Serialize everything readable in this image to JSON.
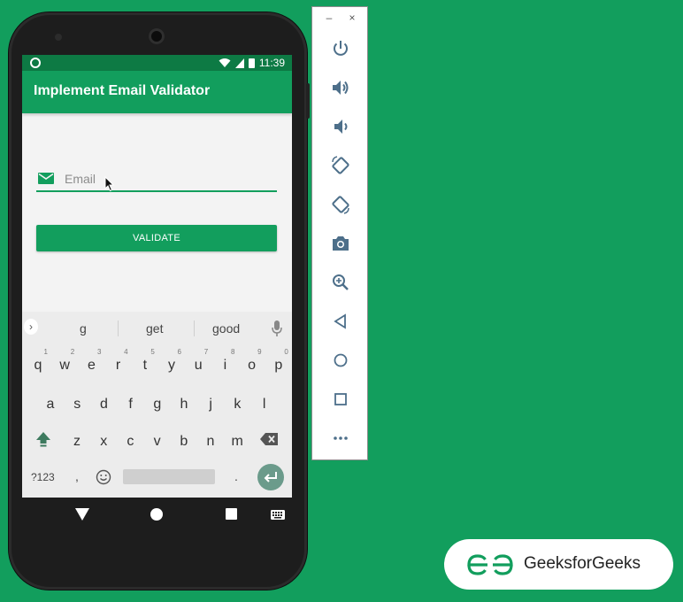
{
  "status_bar": {
    "time": "11:39"
  },
  "app": {
    "title": "Implement Email Validator",
    "email_placeholder": "Email",
    "validate_label": "VALIDATE"
  },
  "keyboard": {
    "suggestions": [
      "g",
      "get",
      "good"
    ],
    "row1": [
      {
        "ch": "q",
        "d": "1"
      },
      {
        "ch": "w",
        "d": "2"
      },
      {
        "ch": "e",
        "d": "3"
      },
      {
        "ch": "r",
        "d": "4"
      },
      {
        "ch": "t",
        "d": "5"
      },
      {
        "ch": "y",
        "d": "6"
      },
      {
        "ch": "u",
        "d": "7"
      },
      {
        "ch": "i",
        "d": "8"
      },
      {
        "ch": "o",
        "d": "9"
      },
      {
        "ch": "p",
        "d": "0"
      }
    ],
    "row2": [
      "a",
      "s",
      "d",
      "f",
      "g",
      "h",
      "j",
      "k",
      "l"
    ],
    "row3": [
      "z",
      "x",
      "c",
      "v",
      "b",
      "n",
      "m"
    ],
    "symbols_label": "?123",
    "comma_label": ",",
    "period_label": "."
  },
  "branding": {
    "name": "GeeksforGeeks"
  },
  "colors": {
    "background": "#129e5d",
    "primary": "#129e5d",
    "status_bar": "#0d7a44"
  },
  "toolbar_icons": [
    "close-icon",
    "power-icon",
    "volume-up-icon",
    "volume-down-icon",
    "rotate-left-icon",
    "rotate-right-icon",
    "camera-icon",
    "zoom-icon",
    "back-icon",
    "home-icon",
    "overview-icon",
    "more-icon"
  ]
}
